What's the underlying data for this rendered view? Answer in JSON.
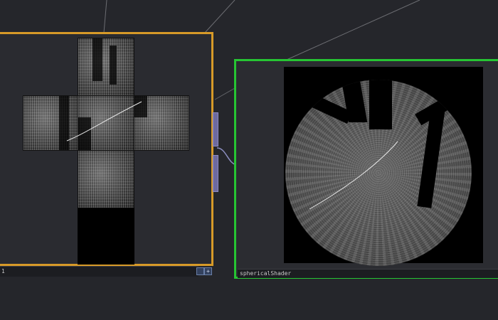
{
  "nodes": {
    "cubemap": {
      "name_partial": "1",
      "border_color": "#d79a28",
      "buttons": [
        "",
        "+"
      ]
    },
    "spherical": {
      "name": "sphericalShader",
      "border_color": "#26c533"
    }
  },
  "colors": {
    "background": "#25262b",
    "wire": "#8c8ec0"
  }
}
